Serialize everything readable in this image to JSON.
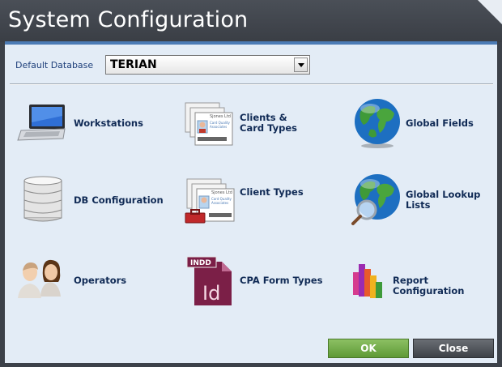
{
  "window": {
    "title": "System Configuration"
  },
  "database": {
    "label": "Default Database",
    "value": "TERIAN"
  },
  "items": [
    {
      "label": "Workstations",
      "icon": "laptop-icon"
    },
    {
      "label": "Clients & Card Types",
      "icon": "id-cards-icon"
    },
    {
      "label": "Global Fields",
      "icon": "globe-icon"
    },
    {
      "label": "DB Configuration",
      "icon": "database-icon"
    },
    {
      "label": "Client Types",
      "icon": "id-cards-toolbox-icon"
    },
    {
      "label": "Global Lookup Lists",
      "icon": "globe-magnifier-icon"
    },
    {
      "label": "Operators",
      "icon": "users-icon"
    },
    {
      "label": "CPA Form Types",
      "icon": "indesign-file-icon",
      "icon_text": "INDD",
      "icon_text_2": "Id"
    },
    {
      "label": "Report Configuration",
      "icon": "bar-chart-icon"
    }
  ],
  "card_text": {
    "line1": "Sjones Ltd",
    "line2": "Card Quality",
    "line3": "Associates"
  },
  "buttons": {
    "ok": "OK",
    "close": "Close"
  },
  "colors": {
    "accent": "#4b7bb5",
    "ok": "#6fa844",
    "close": "#4a4e54",
    "panel": "#e3ecf6"
  }
}
